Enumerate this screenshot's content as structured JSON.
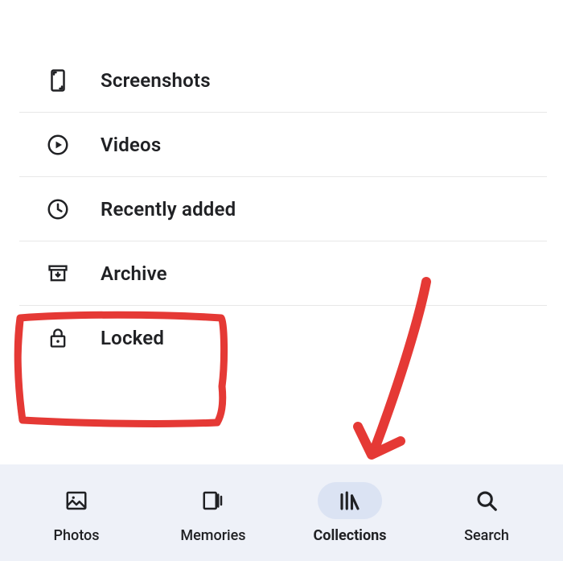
{
  "list": {
    "items": [
      {
        "icon": "screenshot",
        "label": "Screenshots"
      },
      {
        "icon": "play-circle",
        "label": "Videos"
      },
      {
        "icon": "clock",
        "label": "Recently added"
      },
      {
        "icon": "archive",
        "label": "Archive"
      },
      {
        "icon": "lock",
        "label": "Locked"
      }
    ]
  },
  "nav": {
    "items": [
      {
        "icon": "image",
        "label": "Photos",
        "active": false
      },
      {
        "icon": "memories",
        "label": "Memories",
        "active": false
      },
      {
        "icon": "library",
        "label": "Collections",
        "active": true
      },
      {
        "icon": "search",
        "label": "Search",
        "active": false
      }
    ]
  },
  "annotations": {
    "box_around": "Locked",
    "arrow_points_to": "Collections",
    "color": "#e53935"
  }
}
